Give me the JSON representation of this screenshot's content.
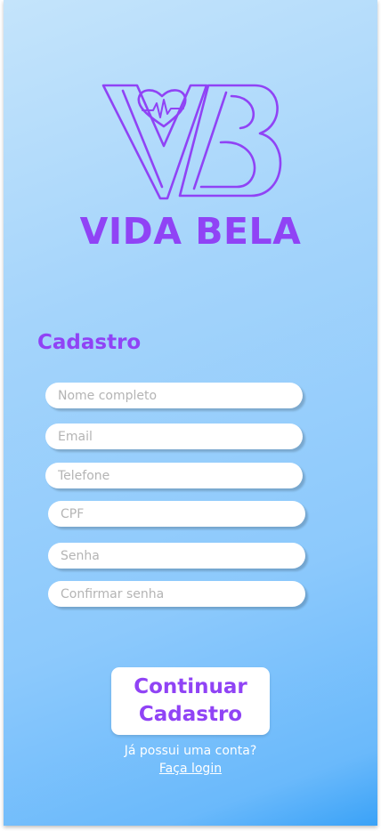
{
  "brand": {
    "name": "VIDA BELA",
    "accent_color": "#9043f5",
    "logo_icon": "heart-pulse-vb-logo-icon"
  },
  "form": {
    "title": "Cadastro",
    "fields": {
      "full_name": {
        "placeholder": "Nome completo",
        "value": ""
      },
      "email": {
        "placeholder": "Email",
        "value": ""
      },
      "phone": {
        "placeholder": "Telefone",
        "value": ""
      },
      "cpf": {
        "placeholder": "CPF",
        "value": ""
      },
      "password": {
        "placeholder": "Senha",
        "value": ""
      },
      "confirm_password": {
        "placeholder": "Confirmar senha",
        "value": ""
      }
    },
    "submit_label_line1": "Continuar",
    "submit_label_line2": "Cadastro"
  },
  "footer": {
    "have_account_text": "Já possui uma conta?",
    "login_link_text": "Faça login"
  }
}
